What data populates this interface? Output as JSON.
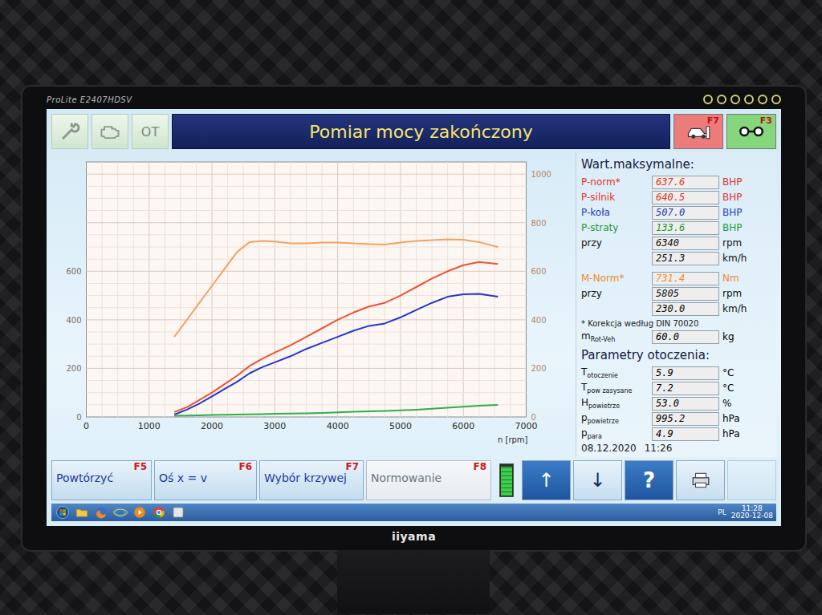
{
  "monitor": {
    "model": "ProLite E2407HDSV",
    "brand": "iiyama"
  },
  "top_bar": {
    "modes": [
      {
        "kind": "wrench"
      },
      {
        "kind": "engine"
      },
      {
        "kind": "text",
        "label": "OT"
      }
    ],
    "title": "Pomiar mocy zakończony",
    "keys": [
      {
        "key": "F7",
        "kind": "car",
        "color": "#ec7b7b"
      },
      {
        "key": "F3",
        "kind": "roller",
        "color": "#86d67e"
      }
    ]
  },
  "chart": {
    "x_ticks": [
      "0",
      "1000",
      "2000",
      "3000",
      "4000",
      "5000",
      "6000",
      "7000"
    ],
    "x_label": "n [rpm]",
    "left_ticks": [
      "0",
      "200",
      "400",
      "600"
    ],
    "right_ticks": [
      "0",
      "200",
      "400",
      "600",
      "800",
      "1000"
    ],
    "rpm": [
      1400,
      1600,
      1800,
      2000,
      2200,
      2400,
      2600,
      2800,
      3000,
      3250,
      3500,
      3750,
      4000,
      4250,
      4500,
      4750,
      5000,
      5250,
      5500,
      5750,
      6000,
      6250,
      6550
    ],
    "series": [
      {
        "axis": "right",
        "color": "#f2a263",
        "values": [
          330,
          400,
          470,
          540,
          610,
          680,
          720,
          725,
          722,
          715,
          715,
          718,
          718,
          715,
          712,
          710,
          718,
          725,
          728,
          731,
          730,
          720,
          700
        ]
      },
      {
        "axis": "left",
        "color": "#ee5236",
        "values": [
          20,
          40,
          70,
          100,
          135,
          170,
          210,
          240,
          265,
          295,
          330,
          365,
          400,
          430,
          455,
          470,
          500,
          535,
          570,
          600,
          625,
          638,
          630
        ]
      },
      {
        "axis": "left",
        "color": "#2438cc",
        "values": [
          10,
          30,
          55,
          85,
          115,
          145,
          180,
          205,
          225,
          250,
          280,
          305,
          330,
          355,
          375,
          385,
          410,
          440,
          470,
          495,
          505,
          507,
          495
        ]
      },
      {
        "axis": "left",
        "color": "#2fae4a",
        "values": [
          5,
          6,
          7,
          8,
          9,
          10,
          11,
          12,
          13,
          14,
          15,
          17,
          19,
          21,
          23,
          25,
          27,
          30,
          34,
          38,
          42,
          46,
          50
        ]
      }
    ]
  },
  "max_values": {
    "title": "Wart.maksymalne:",
    "power": [
      {
        "label": "P-norm*",
        "value": "637.6",
        "unit": "BHP",
        "color": "#e0342a"
      },
      {
        "label": "P-silnik",
        "value": "640.5",
        "unit": "BHP",
        "color": "#e0342a"
      },
      {
        "label": "P-koła",
        "value": "507.0",
        "unit": "BHP",
        "color": "#1f3cc0"
      },
      {
        "label": "P-straty",
        "value": "133.6",
        "unit": "BHP",
        "color": "#1e9a3a"
      },
      {
        "label": "przy",
        "value": "6340",
        "unit": "rpm",
        "color": "#111111"
      },
      {
        "value": "251.3",
        "unit": "km/h",
        "color": "#111111"
      }
    ],
    "torque": [
      {
        "label": "M-Norm*",
        "value": "731.4",
        "unit": "Nm",
        "color": "#ee8a2c"
      },
      {
        "label": "przy",
        "value": "5805",
        "unit": "rpm",
        "color": "#111111"
      },
      {
        "value": "230.0",
        "unit": "km/h",
        "color": "#111111"
      }
    ],
    "note": "* Korekcja według DIN 70020",
    "mass": {
      "symbol": "m",
      "sub": "Rot-Veh",
      "value": "60.0",
      "unit": "kg"
    }
  },
  "ambient": {
    "title": "Parametry otoczenia:",
    "rows": [
      {
        "symbol": "T",
        "sub": "otoczenie",
        "value": "5.9",
        "unit": "°C"
      },
      {
        "symbol": "T",
        "sub": "pow zasysane",
        "value": "7.2",
        "unit": "°C"
      },
      {
        "symbol": "H",
        "sub": "powietrze",
        "value": "53.0",
        "unit": "%"
      },
      {
        "symbol": "p",
        "sub": "powietrze",
        "value": "995.2",
        "unit": "hPa"
      },
      {
        "symbol": "p",
        "sub": "para",
        "value": "4.9",
        "unit": "hPa"
      }
    ]
  },
  "date": "08.12.2020",
  "time": "11:26",
  "function_keys": [
    {
      "label": "Powtórzyć",
      "key": "F5",
      "disabled": false
    },
    {
      "label": "Oś x = v",
      "key": "F6",
      "disabled": false
    },
    {
      "label": "Wybór krzywej",
      "key": "F7",
      "disabled": false
    },
    {
      "label": "Normowanie",
      "key": "F8",
      "disabled": true
    }
  ],
  "signal": {
    "level": 0.95
  },
  "nav_buttons": [
    {
      "kind": "arrow",
      "label": "↑",
      "highlighted": true,
      "disabled": false
    },
    {
      "kind": "arrow",
      "label": "↓",
      "highlighted": false,
      "disabled": false
    },
    {
      "kind": "help",
      "label": "?",
      "highlighted": true,
      "disabled": false
    },
    {
      "kind": "print",
      "highlighted": false,
      "disabled": false
    },
    {
      "kind": "blank",
      "highlighted": false,
      "disabled": true
    }
  ],
  "taskbar": {
    "apps": [
      {
        "kind": "start"
      },
      {
        "kind": "folder"
      },
      {
        "kind": "firefox"
      },
      {
        "kind": "ie"
      },
      {
        "kind": "media"
      },
      {
        "kind": "chrome"
      },
      {
        "kind": "app"
      }
    ],
    "lang": "PL",
    "time": "11:28",
    "date": "2020-12-08"
  }
}
